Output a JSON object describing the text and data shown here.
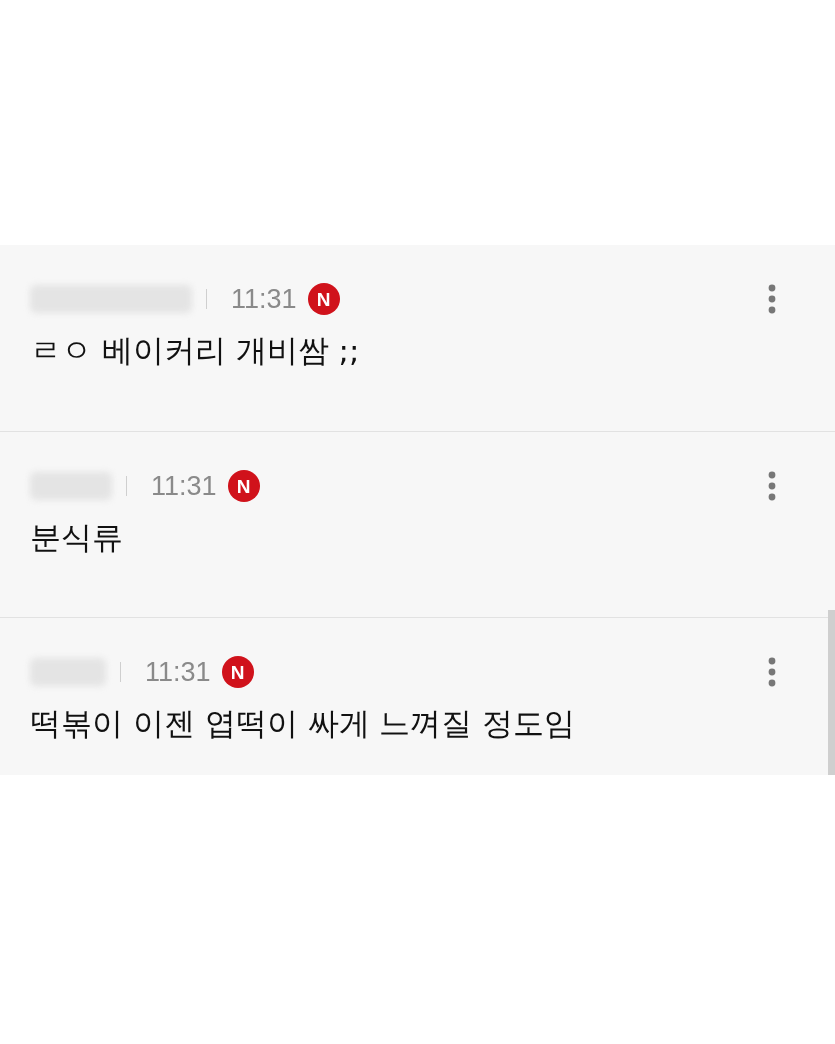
{
  "comments": [
    {
      "time": "11:31",
      "badge": "N",
      "text": "ㄹㅇ 베이커리 개비쌈 ;;"
    },
    {
      "time": "11:31",
      "badge": "N",
      "text": "분식류"
    },
    {
      "time": "11:31",
      "badge": "N",
      "text": "떡볶이 이젠 엽떡이 싸게 느껴질 정도임"
    }
  ]
}
